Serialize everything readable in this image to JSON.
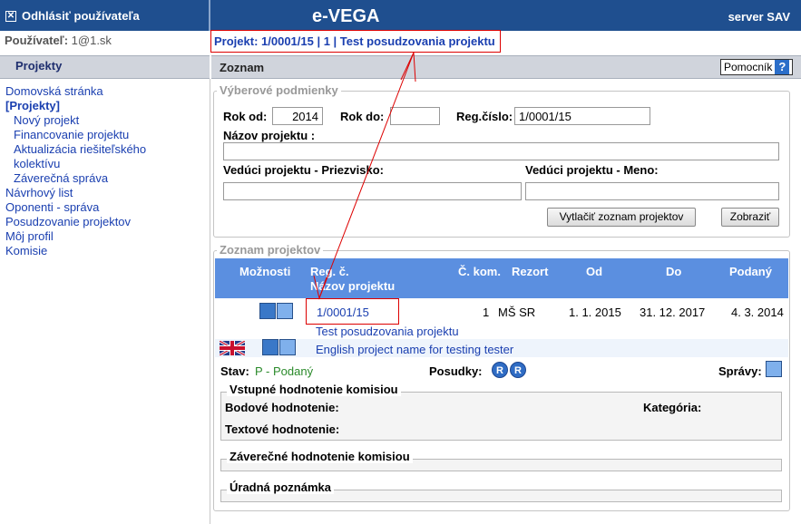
{
  "header": {
    "logout_label": "Odhlásiť používateľa",
    "app_title": "e-VEGA",
    "server_label": "server SAV"
  },
  "user": {
    "label": "Používateľ:",
    "value": "1@1.sk"
  },
  "project_breadcrumb": "Projekt:  1/0001/15 | 1 | Test posudzovania projektu",
  "left_header": "Projekty",
  "main_header": "Zoznam",
  "help_label": "Pomocník",
  "help_icon": "?",
  "nav": [
    {
      "label": "Domovská stránka"
    },
    {
      "label": "[Projekty]"
    },
    {
      "label": "Nový projekt"
    },
    {
      "label": "Financovanie projektu"
    },
    {
      "label": "Aktualizácia riešiteľského"
    },
    {
      "label": "kolektívu"
    },
    {
      "label": "Záverečná správa"
    },
    {
      "label": "Návrhový list"
    },
    {
      "label": "Oponenti - správa"
    },
    {
      "label": "Posudzovanie projektov"
    },
    {
      "label": "Môj profil"
    },
    {
      "label": "Komisie"
    }
  ],
  "filters": {
    "legend": "Výberové podmienky",
    "rok_od_label": "Rok od:",
    "rok_od_value": "2014",
    "rok_do_label": "Rok do:",
    "rok_do_value": "",
    "reg_label": "Reg.číslo:",
    "reg_value": "1/0001/15",
    "nazov_label": "Názov projektu :",
    "nazov_value": "",
    "veduci_priezvisko_label": "Vedúci projektu - Priezvisko:",
    "veduci_priezvisko_value": "",
    "veduci_meno_label": "Vedúci projektu - Meno:",
    "veduci_meno_value": "",
    "print_button": "Vytlačiť zoznam projektov",
    "show_button": "Zobraziť"
  },
  "list": {
    "legend": "Zoznam projektov",
    "columns": {
      "moznosti": "Možnosti",
      "reg": "Reg. č.",
      "nazov": "Názov projektu",
      "ckom": "Č. kom.",
      "rezort": "Rezort",
      "od": "Od",
      "do": "Do",
      "podany": "Podaný"
    },
    "row": {
      "reg": "1/0001/15",
      "ckom": "1",
      "rezort": "MŠ SR",
      "od": "1. 1. 2015",
      "do": "31. 12. 2017",
      "podany": "4. 3. 2014",
      "name_sk": "Test posudzovania projektu",
      "name_en": "English project name for testing tester",
      "stav_label": "Stav:",
      "stav_value": "P - Podaný",
      "posudky_label": "Posudky:",
      "spravy_label": "Správy:",
      "posudky_icon_1": "R",
      "posudky_icon_2": "R"
    },
    "vstupne": {
      "legend": "Vstupné hodnotenie komisiou",
      "bodove": "Bodové hodnotenie:",
      "kategoria": "Kategória:",
      "textove": "Textové hodnotenie:"
    },
    "zaverecne_legend": "Záverečné hodnotenie komisiou",
    "uradna_legend": "Úradná poznámka"
  },
  "colors": {
    "topbar": "#1f4f8f",
    "link": "#1a3fb0",
    "table_header": "#5b8fe0",
    "annotation": "#dd0000"
  }
}
